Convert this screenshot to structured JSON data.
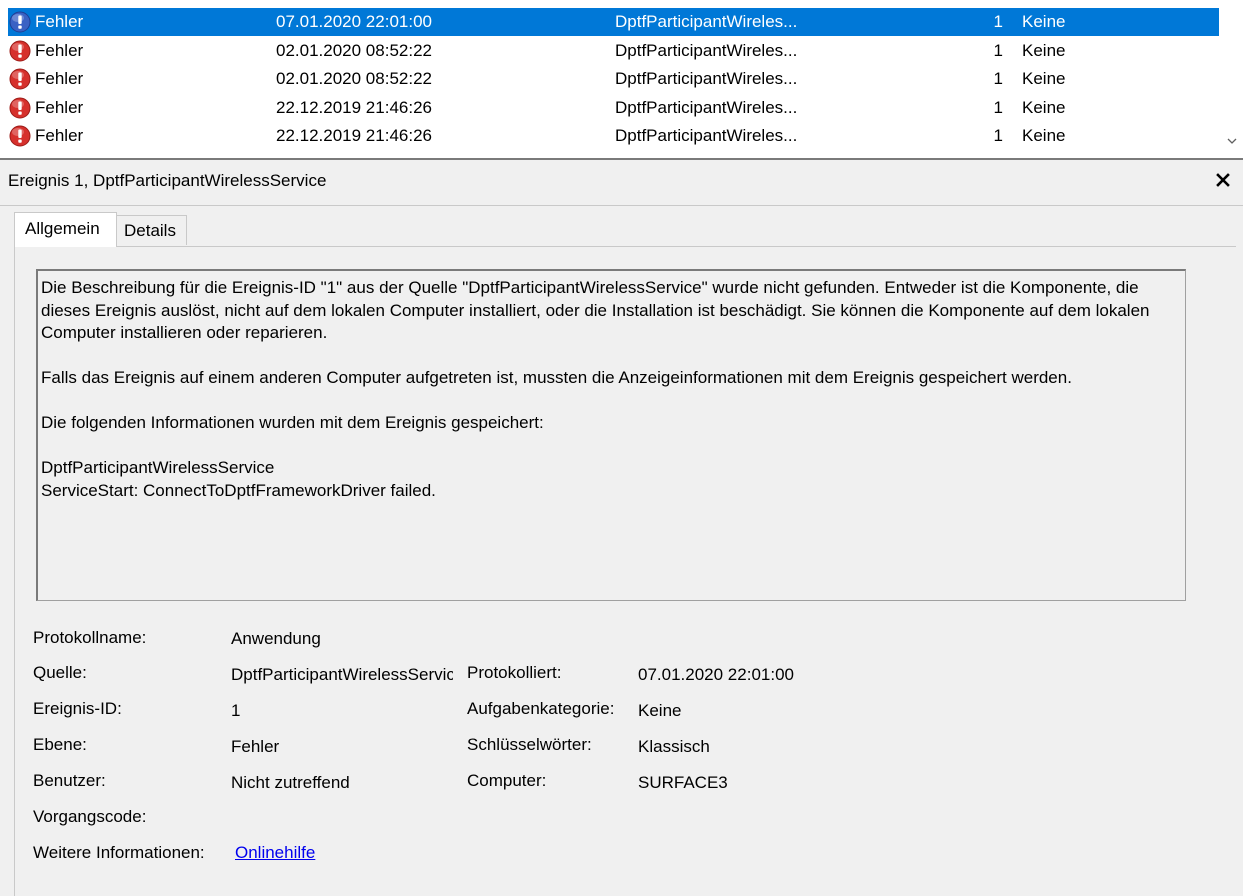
{
  "event_list": {
    "rows": [
      {
        "level": "Fehler",
        "date": "07.01.2020 22:01:00",
        "source": "DptfParticipantWireles...",
        "event_id": "1",
        "category": "Keine",
        "selected": true
      },
      {
        "level": "Fehler",
        "date": "02.01.2020 08:52:22",
        "source": "DptfParticipantWireles...",
        "event_id": "1",
        "category": "Keine",
        "selected": false
      },
      {
        "level": "Fehler",
        "date": "02.01.2020 08:52:22",
        "source": "DptfParticipantWireles...",
        "event_id": "1",
        "category": "Keine",
        "selected": false
      },
      {
        "level": "Fehler",
        "date": "22.12.2019 21:46:26",
        "source": "DptfParticipantWireles...",
        "event_id": "1",
        "category": "Keine",
        "selected": false
      },
      {
        "level": "Fehler",
        "date": "22.12.2019 21:46:26",
        "source": "DptfParticipantWireles...",
        "event_id": "1",
        "category": "Keine",
        "selected": false
      }
    ]
  },
  "detail": {
    "title": "Ereignis 1, DptfParticipantWirelessService",
    "tabs": {
      "general": "Allgemein",
      "details": "Details"
    },
    "description": {
      "p1": "Die Beschreibung für die Ereignis-ID \"1\" aus der Quelle \"DptfParticipantWirelessService\" wurde nicht gefunden. Entweder ist die Komponente, die dieses Ereignis auslöst, nicht auf dem lokalen Computer installiert, oder die Installation ist beschädigt. Sie können die Komponente auf dem lokalen Computer installieren oder reparieren.",
      "p2": "Falls das Ereignis auf einem anderen Computer aufgetreten ist, mussten die Anzeigeinformationen mit dem Ereignis gespeichert werden.",
      "p3": "Die folgenden Informationen wurden mit dem Ereignis gespeichert:",
      "line1": "DptfParticipantWirelessService",
      "line2": "ServiceStart:  ConnectToDptfFrameworkDriver failed."
    },
    "fields": {
      "log_name_label": "Protokollname:",
      "log_name": "Anwendung",
      "source_label": "Quelle:",
      "source": "DptfParticipantWirelessService",
      "logged_label": "Protokolliert:",
      "logged": "07.01.2020 22:01:00",
      "event_id_label": "Ereignis-ID:",
      "event_id": "1",
      "task_category_label": "Aufgabenkategorie:",
      "task_category": "Keine",
      "level_label": "Ebene:",
      "level": "Fehler",
      "keywords_label": "Schlüsselwörter:",
      "keywords": "Klassisch",
      "user_label": "Benutzer:",
      "user": "Nicht zutreffend",
      "computer_label": "Computer:",
      "computer": "SURFACE3",
      "opcode_label": "Vorgangscode:",
      "more_info_label": "Weitere Informationen:",
      "more_info_link": "Onlinehilfe"
    }
  },
  "colors": {
    "selection": "#0078d7",
    "error_icon": "#d6302c",
    "link": "#0000ee"
  }
}
